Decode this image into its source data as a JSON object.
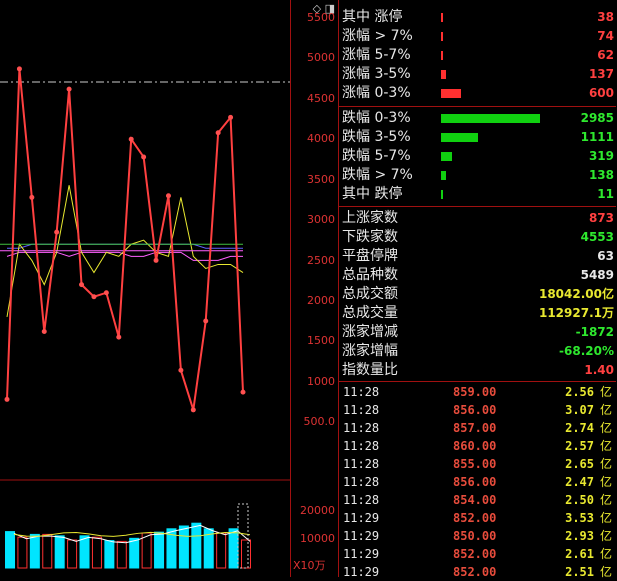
{
  "chart_axis": {
    "price_ticks": [
      "5500",
      "5000",
      "4500",
      "4000",
      "3500",
      "3000",
      "2500",
      "2000",
      "1500",
      "1000",
      "500.0"
    ],
    "volume_ticks": [
      "20000",
      "10000"
    ],
    "volume_unit": "X10万"
  },
  "chart_data": {
    "type": "line",
    "ylim": [
      0,
      5600
    ],
    "series": [
      {
        "values": [
          780,
          4870,
          3280,
          1620,
          2850,
          4620,
          2200,
          2050,
          2100,
          1550,
          4000,
          3780,
          2500,
          3300,
          1140,
          650,
          1750,
          4080,
          4270,
          870
        ]
      },
      {
        "values": [
          1800,
          2700,
          2500,
          2200,
          2600,
          3430,
          2600,
          2350,
          2600,
          2550,
          2700,
          2750,
          2600,
          2550,
          3280,
          2550,
          2400,
          2450,
          2450,
          2350
        ]
      },
      {
        "values": [
          2650,
          2650,
          2700,
          2700,
          2700,
          2700,
          2700,
          2700,
          2700,
          2700,
          2700,
          2700,
          2700,
          2700,
          2700,
          2700,
          2650,
          2650,
          2650,
          2650
        ]
      },
      {
        "values": [
          2550,
          2600,
          2600,
          2600,
          2600,
          2550,
          2600,
          2600,
          2600,
          2600,
          2550,
          2550,
          2600,
          2600,
          2600,
          2500,
          2500,
          2500,
          2550,
          2550
        ]
      }
    ],
    "volume_values": [
      13000,
      11000,
      12000,
      12000,
      11500,
      10000,
      11500,
      11000,
      9800,
      9500,
      10600,
      12500,
      12800,
      14000,
      15000,
      16000,
      14000,
      12500,
      14000,
      10000
    ]
  },
  "up_stats": [
    {
      "label": "其中 涨停",
      "value": "38",
      "ratio": 0.008
    },
    {
      "label": "涨幅 > 7%",
      "value": "74",
      "ratio": 0.015
    },
    {
      "label": "涨幅 5-7%",
      "value": "62",
      "ratio": 0.013
    },
    {
      "label": "涨幅 3-5%",
      "value": "137",
      "ratio": 0.029
    },
    {
      "label": "涨幅 0-3%",
      "value": "600",
      "ratio": 0.125
    }
  ],
  "down_stats": [
    {
      "label": "跌幅 0-3%",
      "value": "2985",
      "ratio": 0.62
    },
    {
      "label": "跌幅 3-5%",
      "value": "1111",
      "ratio": 0.23
    },
    {
      "label": "跌幅 5-7%",
      "value": "319",
      "ratio": 0.066
    },
    {
      "label": "跌幅 > 7%",
      "value": "138",
      "ratio": 0.029
    },
    {
      "label": "其中 跌停",
      "value": "11",
      "ratio": 0.003
    }
  ],
  "summary": [
    {
      "label": "上涨家数",
      "value": "873",
      "color": "red"
    },
    {
      "label": "下跌家数",
      "value": "4553",
      "color": "green"
    },
    {
      "label": "平盘停牌",
      "value": "63",
      "color": "white"
    },
    {
      "label": "总品种数",
      "value": "5489",
      "color": "white"
    },
    {
      "label": "总成交额",
      "value": "18042.00亿",
      "color": "yellow"
    },
    {
      "label": "总成交量",
      "value": "112927.1万",
      "color": "yellow"
    },
    {
      "label": "涨家增减",
      "value": "-1872",
      "color": "green"
    },
    {
      "label": "涨家增幅",
      "value": "-68.20%",
      "color": "green"
    },
    {
      "label": "指数量比",
      "value": "1.40",
      "color": "red"
    }
  ],
  "ticks": [
    {
      "time": "11:28",
      "price": "859.00",
      "amount": "2.56",
      "unit": "亿"
    },
    {
      "time": "11:28",
      "price": "856.00",
      "amount": "3.07",
      "unit": "亿"
    },
    {
      "time": "11:28",
      "price": "857.00",
      "amount": "2.74",
      "unit": "亿"
    },
    {
      "time": "11:28",
      "price": "860.00",
      "amount": "2.57",
      "unit": "亿"
    },
    {
      "time": "11:28",
      "price": "855.00",
      "amount": "2.65",
      "unit": "亿"
    },
    {
      "time": "11:28",
      "price": "856.00",
      "amount": "2.47",
      "unit": "亿"
    },
    {
      "time": "11:28",
      "price": "854.00",
      "amount": "2.50",
      "unit": "亿"
    },
    {
      "time": "11:29",
      "price": "852.00",
      "amount": "3.53",
      "unit": "亿"
    },
    {
      "time": "11:29",
      "price": "850.00",
      "amount": "2.93",
      "unit": "亿"
    },
    {
      "time": "11:29",
      "price": "852.00",
      "amount": "2.61",
      "unit": "亿"
    },
    {
      "time": "11:29",
      "price": "852.00",
      "amount": "2.51",
      "unit": "亿"
    }
  ],
  "colors": {
    "up": "#ff3030",
    "down": "#10d010",
    "grid": "#8a0000",
    "bar_up": "#00e5ff"
  }
}
